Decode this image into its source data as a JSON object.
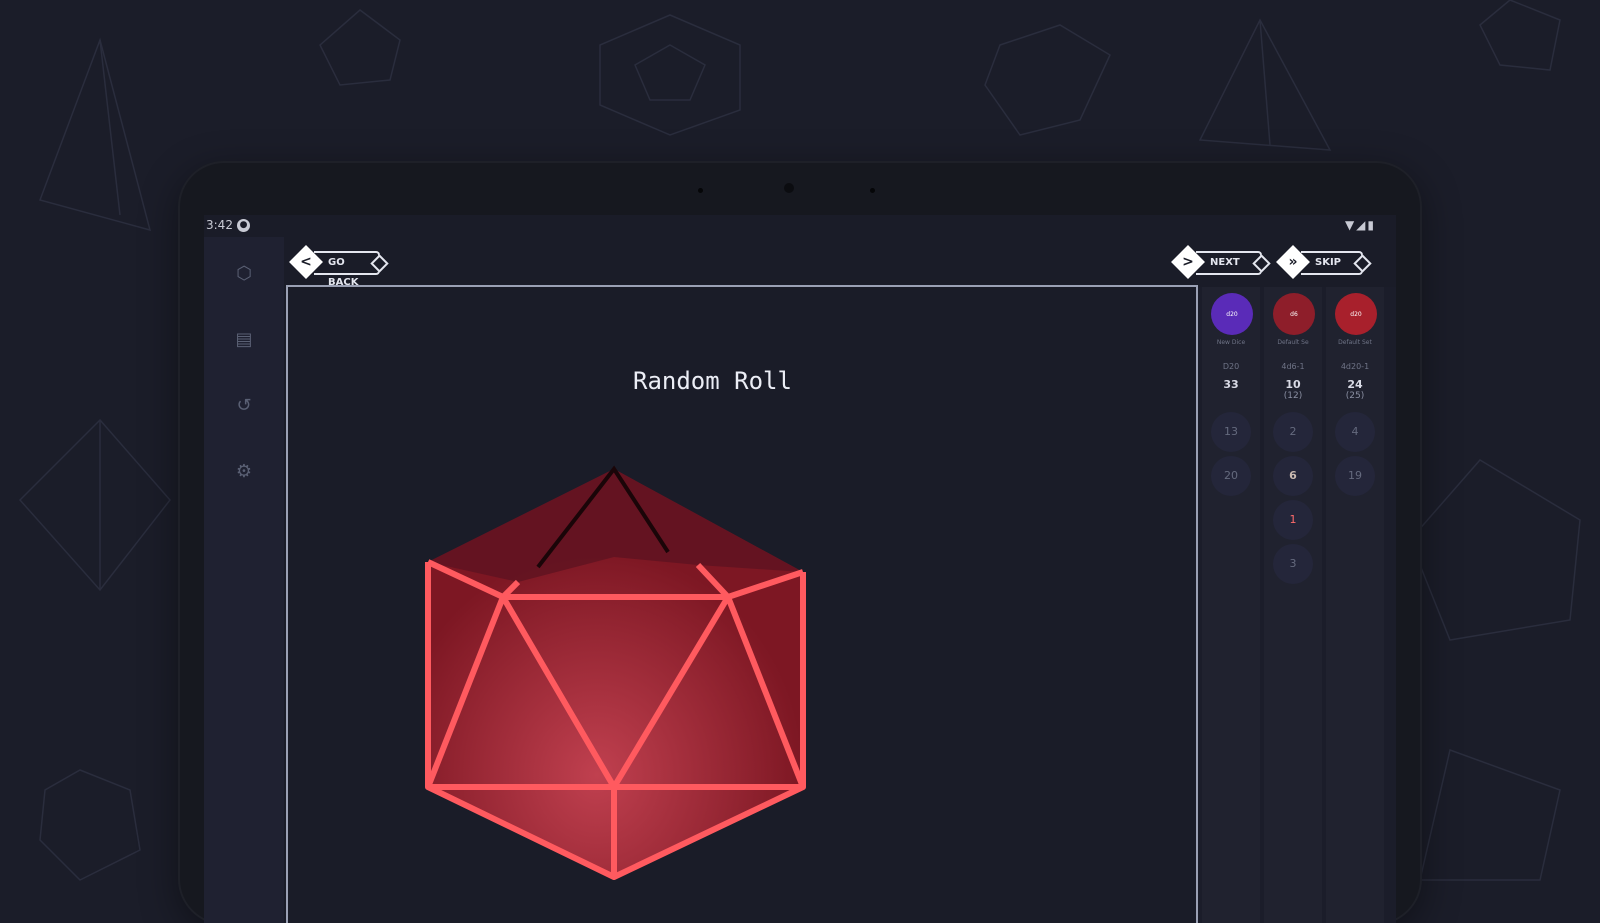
{
  "statusbar": {
    "time": "3:42",
    "system_icons": "▼◢▮"
  },
  "nav": {
    "back_label": "GO BACK",
    "next_label": "NEXT",
    "skip_label": "SKIP"
  },
  "rail": {
    "items": [
      {
        "name": "dice-icon",
        "glyph": "⬡"
      },
      {
        "name": "library-icon",
        "glyph": "▤"
      },
      {
        "name": "history-icon",
        "glyph": "↺"
      },
      {
        "name": "settings-icon",
        "glyph": "⚙"
      }
    ]
  },
  "main": {
    "title": "Random Roll"
  },
  "colors": {
    "die_fill": "#7d1723",
    "die_edge": "#ff5a5f",
    "accent_purple": "#5a2bb8"
  },
  "players": [
    {
      "badge": "d20",
      "name": "New Dice",
      "label": "D20",
      "total": "33",
      "sub": "",
      "color": "#5a2bb8",
      "rolls": [
        {
          "v": "13",
          "c": "dim"
        },
        {
          "v": "20",
          "c": "dim"
        }
      ]
    },
    {
      "badge": "d6",
      "name": "Default Se",
      "label": "4d6-1",
      "total": "10",
      "sub": "(12)",
      "color": "#8e1e2a",
      "rolls": [
        {
          "v": "2",
          "c": "dim"
        },
        {
          "v": "6",
          "c": "mid"
        },
        {
          "v": "1",
          "c": "hot"
        },
        {
          "v": "3",
          "c": "dim"
        }
      ]
    },
    {
      "badge": "d20",
      "name": "Default Set",
      "label": "4d20-1",
      "total": "24",
      "sub": "(25)",
      "color": "#a8202c",
      "rolls": [
        {
          "v": "4",
          "c": "dim"
        },
        {
          "v": "19",
          "c": "dim"
        }
      ]
    }
  ]
}
